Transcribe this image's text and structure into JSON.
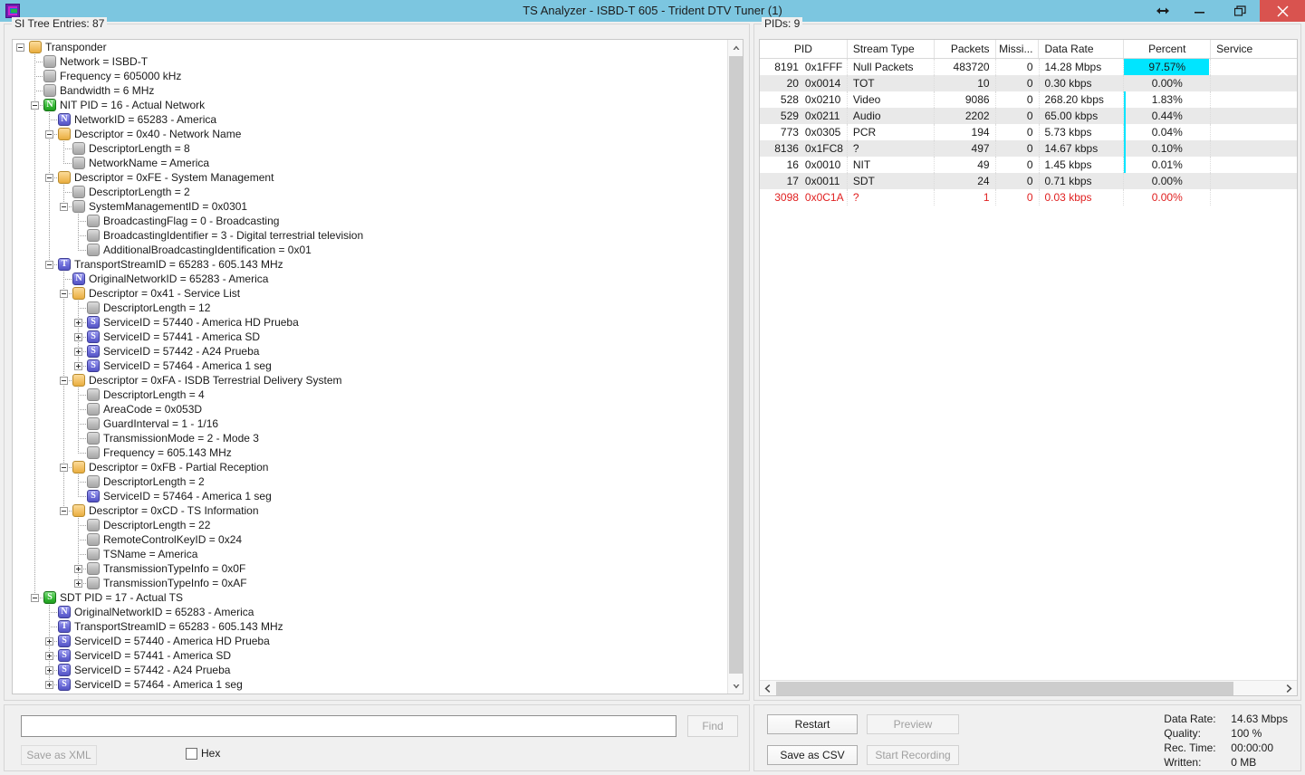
{
  "window": {
    "title": "TS Analyzer - ISBD-T 605 - Trident DTV Tuner (1)",
    "app_icon": "app-logo-icon",
    "controls": {
      "resize": "resize-arrows-icon",
      "minimize": "minimize-icon",
      "restore": "restore-icon",
      "close": "close-icon"
    }
  },
  "left_panel": {
    "label": "SI Tree Entries: 87",
    "tree": [
      {
        "depth": 0,
        "expander": "minus",
        "icon": "folder",
        "text": "Transponder"
      },
      {
        "depth": 1,
        "expander": "none",
        "icon": "leaf",
        "text": "Network = ISBD-T"
      },
      {
        "depth": 1,
        "expander": "none",
        "icon": "leaf",
        "text": "Frequency = 605000 kHz"
      },
      {
        "depth": 1,
        "expander": "none",
        "icon": "leaf",
        "text": "Bandwidth = 6 MHz"
      },
      {
        "depth": 1,
        "expander": "minus",
        "icon": "green-n",
        "text": "NIT PID = 16 - Actual Network"
      },
      {
        "depth": 2,
        "expander": "none",
        "icon": "blue-n",
        "text": "NetworkID = 65283 - America"
      },
      {
        "depth": 2,
        "expander": "minus",
        "icon": "folder",
        "text": "Descriptor = 0x40 - Network Name"
      },
      {
        "depth": 3,
        "expander": "none",
        "icon": "leaf",
        "text": "DescriptorLength = 8"
      },
      {
        "depth": 3,
        "expander": "none",
        "icon": "leaf",
        "text": "NetworkName = America"
      },
      {
        "depth": 2,
        "expander": "minus",
        "icon": "folder",
        "text": "Descriptor = 0xFE - System Management"
      },
      {
        "depth": 3,
        "expander": "none",
        "icon": "leaf",
        "text": "DescriptorLength = 2"
      },
      {
        "depth": 3,
        "expander": "minus",
        "icon": "leaf",
        "text": "SystemManagementID = 0x0301"
      },
      {
        "depth": 4,
        "expander": "none",
        "icon": "leaf",
        "text": "BroadcastingFlag = 0 - Broadcasting"
      },
      {
        "depth": 4,
        "expander": "none",
        "icon": "leaf",
        "text": "BroadcastingIdentifier = 3 - Digital terrestrial television"
      },
      {
        "depth": 4,
        "expander": "none",
        "icon": "leaf",
        "text": "AdditionalBroadcastingIdentification = 0x01"
      },
      {
        "depth": 2,
        "expander": "minus",
        "icon": "blue-t",
        "text": "TransportStreamID = 65283 - 605.143 MHz"
      },
      {
        "depth": 3,
        "expander": "none",
        "icon": "blue-n",
        "text": "OriginalNetworkID = 65283 - America"
      },
      {
        "depth": 3,
        "expander": "minus",
        "icon": "folder",
        "text": "Descriptor = 0x41 - Service List"
      },
      {
        "depth": 4,
        "expander": "none",
        "icon": "leaf",
        "text": "DescriptorLength = 12"
      },
      {
        "depth": 4,
        "expander": "plus",
        "icon": "blue-s",
        "text": "ServiceID = 57440 - America HD Prueba"
      },
      {
        "depth": 4,
        "expander": "plus",
        "icon": "blue-s",
        "text": "ServiceID = 57441 - America SD"
      },
      {
        "depth": 4,
        "expander": "plus",
        "icon": "blue-s",
        "text": "ServiceID = 57442 - A24 Prueba"
      },
      {
        "depth": 4,
        "expander": "plus",
        "icon": "blue-s",
        "text": "ServiceID = 57464 - America 1 seg"
      },
      {
        "depth": 3,
        "expander": "minus",
        "icon": "folder",
        "text": "Descriptor = 0xFA - ISDB Terrestrial Delivery System"
      },
      {
        "depth": 4,
        "expander": "none",
        "icon": "leaf",
        "text": "DescriptorLength = 4"
      },
      {
        "depth": 4,
        "expander": "none",
        "icon": "leaf",
        "text": "AreaCode = 0x053D"
      },
      {
        "depth": 4,
        "expander": "none",
        "icon": "leaf",
        "text": "GuardInterval = 1 - 1/16"
      },
      {
        "depth": 4,
        "expander": "none",
        "icon": "leaf",
        "text": "TransmissionMode = 2 - Mode 3"
      },
      {
        "depth": 4,
        "expander": "none",
        "icon": "leaf",
        "text": "Frequency = 605.143 MHz"
      },
      {
        "depth": 3,
        "expander": "minus",
        "icon": "folder",
        "text": "Descriptor = 0xFB - Partial Reception"
      },
      {
        "depth": 4,
        "expander": "none",
        "icon": "leaf",
        "text": "DescriptorLength = 2"
      },
      {
        "depth": 4,
        "expander": "none",
        "icon": "blue-s",
        "text": "ServiceID = 57464 - America 1 seg"
      },
      {
        "depth": 3,
        "expander": "minus",
        "icon": "folder",
        "text": "Descriptor = 0xCD - TS Information"
      },
      {
        "depth": 4,
        "expander": "none",
        "icon": "leaf",
        "text": "DescriptorLength = 22"
      },
      {
        "depth": 4,
        "expander": "none",
        "icon": "leaf",
        "text": "RemoteControlKeyID = 0x24"
      },
      {
        "depth": 4,
        "expander": "none",
        "icon": "leaf",
        "text": "TSName = America"
      },
      {
        "depth": 4,
        "expander": "plus",
        "icon": "leaf",
        "text": "TransmissionTypeInfo = 0x0F"
      },
      {
        "depth": 4,
        "expander": "plus",
        "icon": "leaf",
        "text": "TransmissionTypeInfo = 0xAF"
      },
      {
        "depth": 1,
        "expander": "minus",
        "icon": "green-s",
        "text": "SDT PID = 17 - Actual TS"
      },
      {
        "depth": 2,
        "expander": "none",
        "icon": "blue-n",
        "text": "OriginalNetworkID = 65283 - America"
      },
      {
        "depth": 2,
        "expander": "none",
        "icon": "blue-t",
        "text": "TransportStreamID = 65283 - 605.143 MHz"
      },
      {
        "depth": 2,
        "expander": "plus",
        "icon": "blue-s",
        "text": "ServiceID = 57440 - America HD Prueba"
      },
      {
        "depth": 2,
        "expander": "plus",
        "icon": "blue-s",
        "text": "ServiceID = 57441 - America SD"
      },
      {
        "depth": 2,
        "expander": "plus",
        "icon": "blue-s",
        "text": "ServiceID = 57442 - A24 Prueba"
      },
      {
        "depth": 2,
        "expander": "plus",
        "icon": "blue-s",
        "text": "ServiceID = 57464 - America 1 seg"
      }
    ],
    "scrollbar": {
      "up_arrow": "scroll-up-icon",
      "down_arrow": "scroll-down-icon"
    }
  },
  "left_bottom": {
    "find_value": "",
    "find_placeholder": "",
    "find_label": "Find",
    "find_enabled": false,
    "save_xml_label": "Save as XML",
    "save_xml_enabled": false,
    "hex_label": "Hex",
    "hex_checked": false
  },
  "right_panel": {
    "label": "PIDs: 9",
    "columns": [
      "PID",
      "Stream Type",
      "Packets",
      "Missi...",
      "Data Rate",
      "Percent",
      "Service"
    ],
    "rows": [
      {
        "pid": "8191",
        "hex": "0x1FFF",
        "stream": "Null Packets",
        "packets": "483720",
        "missing": "0",
        "rate": "14.28 Mbps",
        "percent": "97.57%",
        "percent_value": 97.57,
        "service": "",
        "error": false
      },
      {
        "pid": "20",
        "hex": "0x0014",
        "stream": "TOT",
        "packets": "10",
        "missing": "0",
        "rate": "0.30 kbps",
        "percent": "0.00%",
        "percent_value": 0.0,
        "service": "",
        "error": false
      },
      {
        "pid": "528",
        "hex": "0x0210",
        "stream": "Video",
        "packets": "9086",
        "missing": "0",
        "rate": "268.20 kbps",
        "percent": "1.83%",
        "percent_value": 1.83,
        "service": "",
        "error": false
      },
      {
        "pid": "529",
        "hex": "0x0211",
        "stream": "Audio",
        "packets": "2202",
        "missing": "0",
        "rate": "65.00 kbps",
        "percent": "0.44%",
        "percent_value": 0.44,
        "service": "",
        "error": false
      },
      {
        "pid": "773",
        "hex": "0x0305",
        "stream": "PCR",
        "packets": "194",
        "missing": "0",
        "rate": "5.73 kbps",
        "percent": "0.04%",
        "percent_value": 0.04,
        "service": "",
        "error": false
      },
      {
        "pid": "8136",
        "hex": "0x1FC8",
        "stream": "?",
        "packets": "497",
        "missing": "0",
        "rate": "14.67 kbps",
        "percent": "0.10%",
        "percent_value": 0.1,
        "service": "",
        "error": false
      },
      {
        "pid": "16",
        "hex": "0x0010",
        "stream": "NIT",
        "packets": "49",
        "missing": "0",
        "rate": "1.45 kbps",
        "percent": "0.01%",
        "percent_value": 0.01,
        "service": "",
        "error": false
      },
      {
        "pid": "17",
        "hex": "0x0011",
        "stream": "SDT",
        "packets": "24",
        "missing": "0",
        "rate": "0.71 kbps",
        "percent": "0.00%",
        "percent_value": 0.0,
        "service": "",
        "error": false
      },
      {
        "pid": "3098",
        "hex": "0x0C1A",
        "stream": "?",
        "packets": "1",
        "missing": "0",
        "rate": "0.03 kbps",
        "percent": "0.00%",
        "percent_value": 0.0,
        "service": "",
        "error": true
      }
    ],
    "percent_bar_color": "#00e5ff",
    "error_color": "#e02020",
    "scrollbar": {
      "left_arrow": "scroll-left-icon",
      "right_arrow": "scroll-right-icon"
    }
  },
  "right_bottom": {
    "restart_label": "Restart",
    "restart_enabled": true,
    "preview_label": "Preview",
    "preview_enabled": false,
    "save_csv_label": "Save as CSV",
    "save_csv_enabled": true,
    "start_recording_label": "Start Recording",
    "start_recording_enabled": false,
    "stats": [
      {
        "key": "Data Rate:",
        "value": "14.63 Mbps"
      },
      {
        "key": "Quality:",
        "value": "100 %"
      },
      {
        "key": "Rec. Time:",
        "value": "00:00:00"
      },
      {
        "key": "Written:",
        "value": "0 MB"
      }
    ]
  }
}
